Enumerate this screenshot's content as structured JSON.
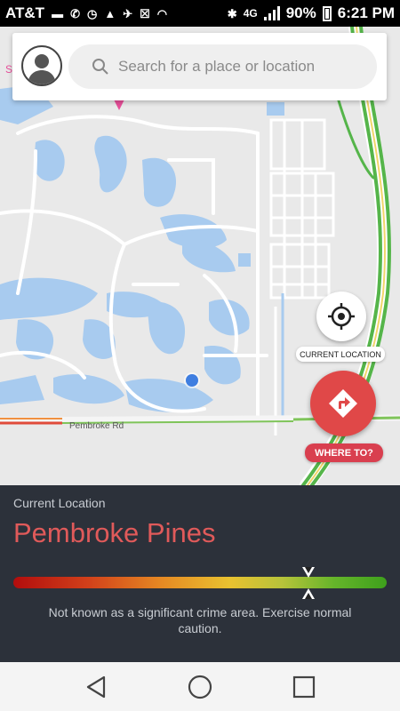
{
  "status_bar": {
    "carrier": "AT&T",
    "network": "4G",
    "battery": "90%",
    "time": "6:21 PM"
  },
  "search": {
    "placeholder": "Search for a place or location"
  },
  "map": {
    "road_label": "Pembroke Rd"
  },
  "buttons": {
    "current_location_label": "CURRENT LOCATION",
    "where_to_label": "WHERE TO?"
  },
  "info_panel": {
    "label": "Current Location",
    "place": "Pembroke Pines",
    "safety_level": 0.79,
    "description": "Not known as a significant crime area. Exercise normal caution."
  },
  "nav": {
    "back": "back-icon",
    "home": "home-icon",
    "recents": "recents-icon"
  },
  "colors": {
    "accent_red": "#e04848",
    "panel_bg": "#2c313a",
    "place_text": "#e05a5a",
    "water": "#a8cbef",
    "location_dot": "#3f7ee0"
  }
}
